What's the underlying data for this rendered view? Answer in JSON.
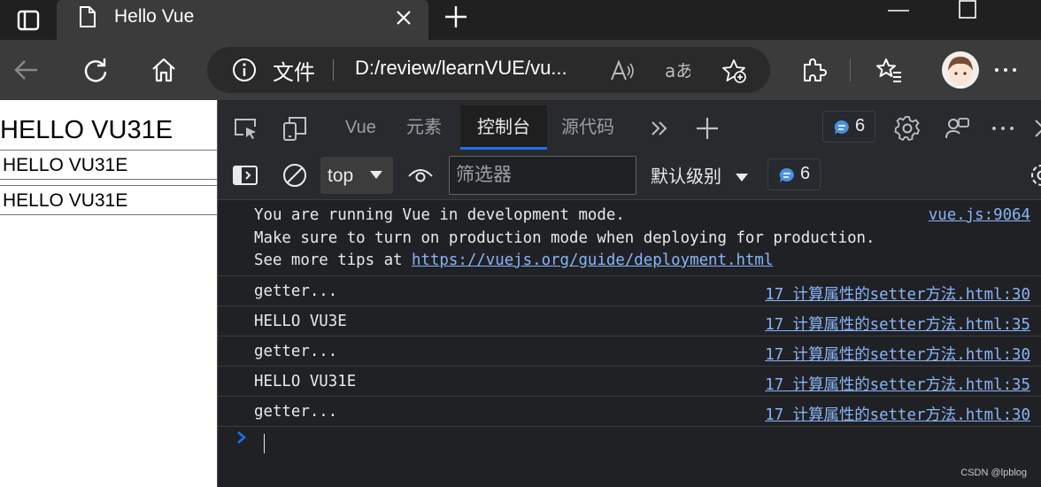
{
  "browser": {
    "tab_title": "Hello Vue",
    "address": {
      "scheme_label": "文件",
      "url": "D:/review/learnVUE/vu..."
    }
  },
  "page": {
    "heading": "HELLO VU31E",
    "inputs": [
      "HELLO VU31E",
      "HELLO VU31E"
    ]
  },
  "devtools": {
    "tabs": [
      "Vue",
      "元素",
      "控制台",
      "源代码"
    ],
    "active_tab": "控制台",
    "issues_badge_count": "6",
    "context": "top",
    "filter_placeholder": "筛选器",
    "log_level": "默认级别",
    "messages_badge_count": "6",
    "console": {
      "dev_message": {
        "line1": "You are running Vue in development mode.",
        "line2": "Make sure to turn on production mode when deploying for production.",
        "line3_prefix": "See more tips at ",
        "line3_link": "https://vuejs.org/guide/deployment.html",
        "source": "vue.js:9064"
      },
      "logs": [
        {
          "text": "getter...",
          "source": "17 计算属性的setter方法.html:30"
        },
        {
          "text": "HELLO VU3E",
          "source": "17 计算属性的setter方法.html:35"
        },
        {
          "text": "getter...",
          "source": "17 计算属性的setter方法.html:30"
        },
        {
          "text": "HELLO VU31E",
          "source": "17 计算属性的setter方法.html:35"
        },
        {
          "text": "getter...",
          "source": "17 计算属性的setter方法.html:30"
        }
      ]
    }
  },
  "watermark": "CSDN @lpblog",
  "colors": {
    "devtools_bg": "#202124",
    "link": "#8ab4f8",
    "accent": "#1a73e8",
    "badge_icon": "#4a90e2"
  }
}
